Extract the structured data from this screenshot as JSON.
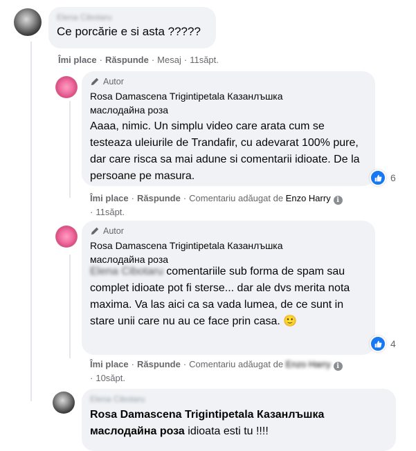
{
  "comment1": {
    "author": "Elena Cibotaru",
    "text": "Ce porcărie e si asta ?????",
    "actions": {
      "like": "Îmi place",
      "reply": "Răspunde",
      "message": "Mesaj",
      "time": "11săpt."
    }
  },
  "reply1": {
    "badge": "Autor",
    "author": "Rosa Damascena Trigintipetala Казанлъшка маслодайна роза",
    "text": "Aaaa, nimic. Un simplu video care arata cum se testeaza uleiurile de Trandafir, cu adevarat 100% pure, dar care risca sa mai adune si comentarii idioate. De la persoane pe masura.",
    "reactions": "6",
    "actions": {
      "like": "Îmi place",
      "reply": "Răspunde",
      "added_by": "Comentariu adăugat de",
      "added_name": "Enzo Harry",
      "time": "11săpt."
    }
  },
  "reply2": {
    "badge": "Autor",
    "author": "Rosa Damascena Trigintipetala Казанлъшка маслодайна роза",
    "mention": "Elena Cibotaru",
    "text": " comentariile sub forma de spam sau complet idioate pot fi sterse... dar ale dvs merita nota maxima. Va las aici ca sa vada lumea, de ce sunt in stare unii care nu au ce face prin casa. 🙂",
    "reactions": "4",
    "actions": {
      "like": "Îmi place",
      "reply": "Răspunde",
      "added_by": "Comentariu adăugat de",
      "added_name": "Enzo Harry",
      "time": "10săpt."
    }
  },
  "reply3": {
    "author": "Elena Cibotaru",
    "mention": "Rosa Damascena Trigintipetala Казанлъшка маслодайна роза",
    "text": " idioata esti tu !!!!"
  },
  "colors": {
    "like_blue": "#1877f2",
    "bubble": "#f0f2f5",
    "meta": "#65676b"
  }
}
